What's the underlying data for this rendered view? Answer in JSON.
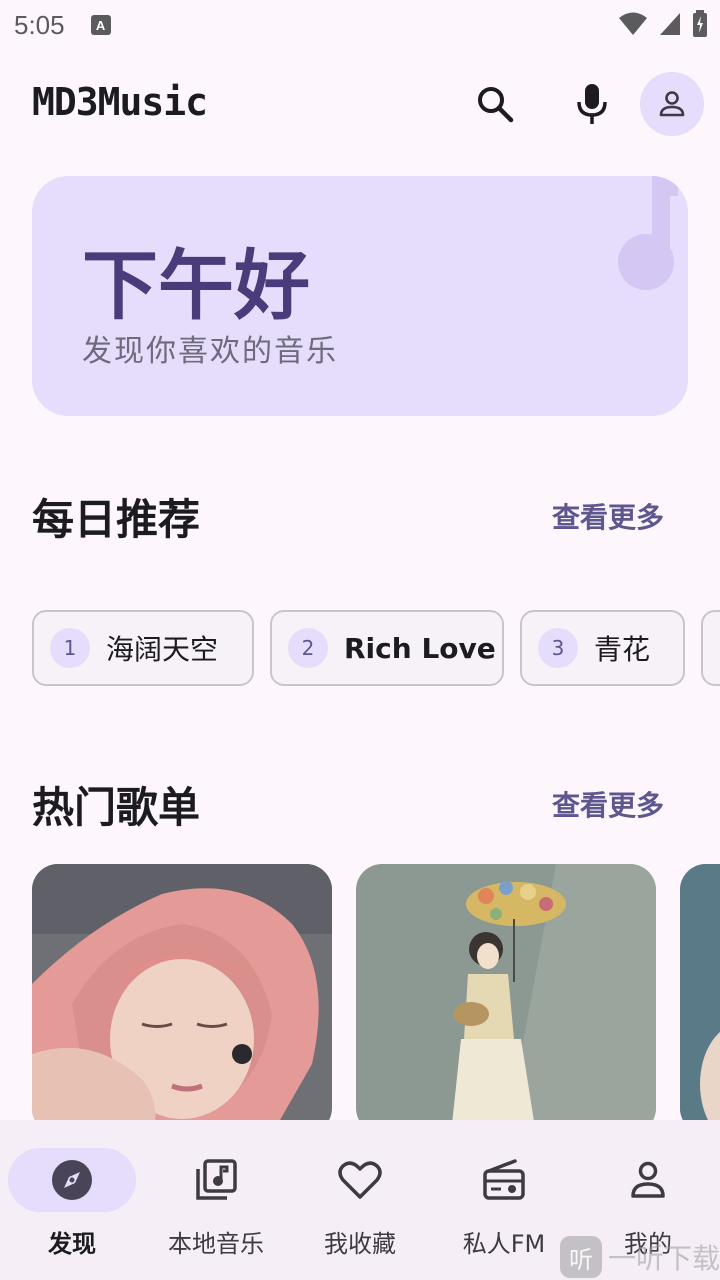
{
  "status_bar": {
    "time": "5:05",
    "app_icon_letter": "A"
  },
  "top_bar": {
    "title": "MD3Music"
  },
  "greeting": {
    "title": "下午好",
    "subtitle": "发现你喜欢的音乐"
  },
  "daily": {
    "title": "每日推荐",
    "see_more": "查看更多",
    "songs": [
      {
        "num": "1",
        "name": "海阔天空"
      },
      {
        "num": "2",
        "name": "Rich Love"
      },
      {
        "num": "3",
        "name": "青花"
      }
    ]
  },
  "hot": {
    "title": "热门歌单",
    "see_more": "查看更多"
  },
  "nav": {
    "items": [
      {
        "label": "发现",
        "icon": "compass-icon",
        "active": true
      },
      {
        "label": "本地音乐",
        "icon": "library-music-icon"
      },
      {
        "label": "我收藏",
        "icon": "heart-icon"
      },
      {
        "label": "私人FM",
        "icon": "radio-icon"
      },
      {
        "label": "我的",
        "icon": "person-icon"
      }
    ]
  },
  "watermark": {
    "logo_char": "听",
    "text": "一听下载"
  },
  "colors": {
    "accent": "#5e578f",
    "container": "#e6dcfb",
    "background": "#fdf7fd"
  }
}
